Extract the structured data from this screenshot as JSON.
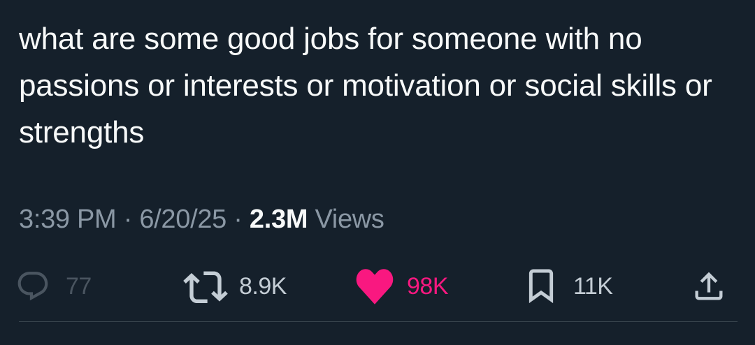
{
  "tweet": {
    "text": "what are some good jobs for someone with no passions or interests or motivation or social skills or strengths"
  },
  "meta": {
    "time": "3:39 PM",
    "separator": "·",
    "date": "6/20/25",
    "views_count": "2.3M",
    "views_label": "Views"
  },
  "actions": {
    "reply": {
      "icon": "reply-bubble-icon",
      "count": "77"
    },
    "retweet": {
      "icon": "retweet-arrows-icon",
      "count": "8.9K"
    },
    "like": {
      "icon": "heart-filled-icon",
      "count": "98K",
      "color": "#f91880"
    },
    "bookmark": {
      "icon": "bookmark-icon",
      "count": "11K"
    },
    "share": {
      "icon": "share-upload-icon"
    }
  },
  "colors": {
    "background": "#15202b",
    "text": "#f7f9f9",
    "muted": "#8b98a5",
    "like": "#f91880",
    "divider": "#38444d"
  }
}
